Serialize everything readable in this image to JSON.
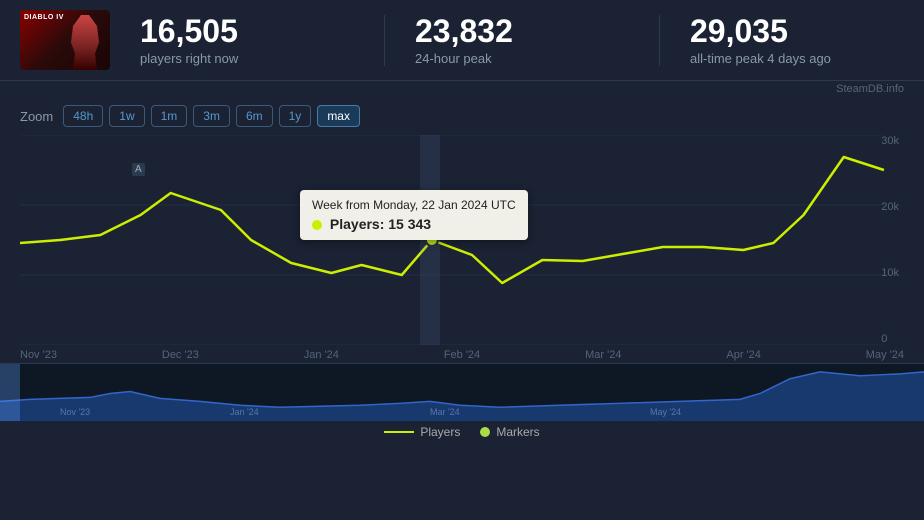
{
  "game": {
    "name": "Diablo IV",
    "thumbnail_alt": "Diablo IV game cover"
  },
  "stats": {
    "current": {
      "value": "16,505",
      "label": "players right now"
    },
    "peak24h": {
      "value": "23,832",
      "label": "24-hour peak"
    },
    "alltime": {
      "value": "29,035",
      "label": "all-time peak 4 days ago"
    }
  },
  "watermark": "SteamDB.info",
  "zoom": {
    "label": "Zoom",
    "options": [
      "48h",
      "1w",
      "1m",
      "3m",
      "6m",
      "1y",
      "max"
    ],
    "active": "max"
  },
  "chart": {
    "y_labels": [
      "30k",
      "20k",
      "10k",
      "0"
    ],
    "x_labels": [
      "Nov '23",
      "Dec '23",
      "Jan '24",
      "Feb '24",
      "Mar '24",
      "Apr '24",
      "May '24"
    ],
    "tooltip": {
      "title": "Week from Monday, 22 Jan 2024 UTC",
      "label": "Players:",
      "value": "15 343"
    }
  },
  "legend": {
    "players_label": "Players",
    "markers_label": "Markers"
  }
}
